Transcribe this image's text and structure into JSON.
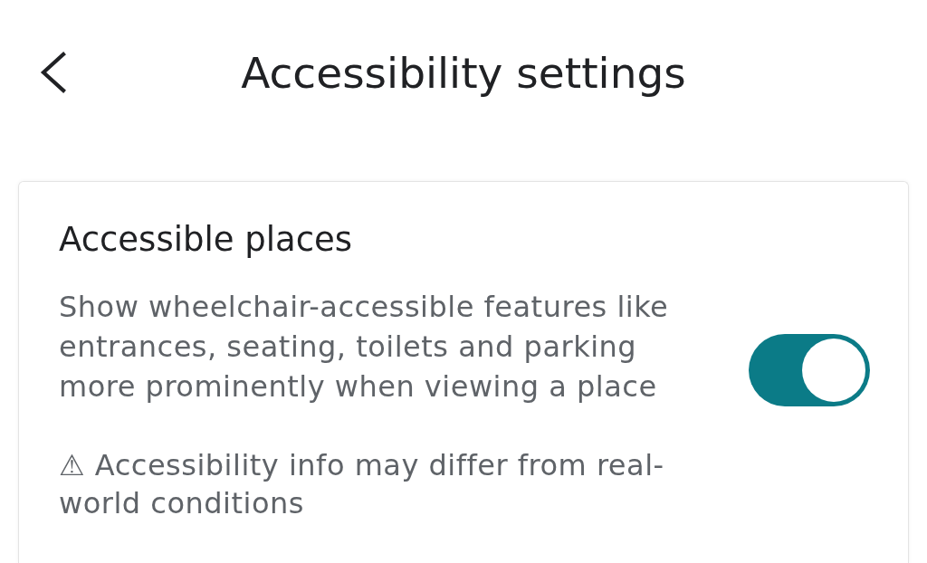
{
  "header": {
    "title": "Accessibility settings"
  },
  "card": {
    "title": "Accessible places",
    "description": "Show wheelchair-accessible features like entrances, seating, toilets and parking more prominently when viewing a place",
    "toggle": {
      "on": true
    },
    "warning": "⚠ Accessibility info may differ from real-world conditions"
  }
}
